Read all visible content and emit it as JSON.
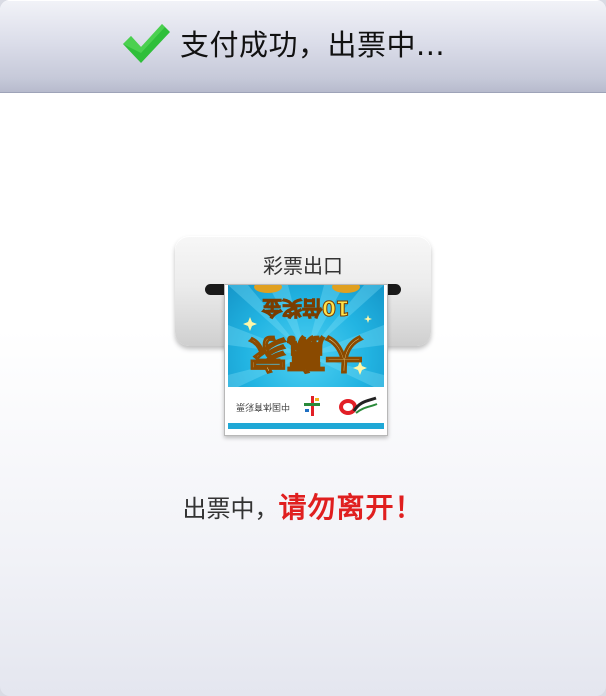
{
  "header": {
    "title": "支付成功，出票中...",
    "icon": "check-icon",
    "icon_color": "#2fbf3a"
  },
  "printer": {
    "label": "彩票出口"
  },
  "ticket": {
    "prize_text": "10倍奖金",
    "big_text": "大赢家",
    "org_text": "中国体育彩票",
    "banner_color": "#22b4e2"
  },
  "status": {
    "normal_text": "出票中，",
    "warning_text": "请勿离开！",
    "warning_color": "#e01f1f"
  }
}
